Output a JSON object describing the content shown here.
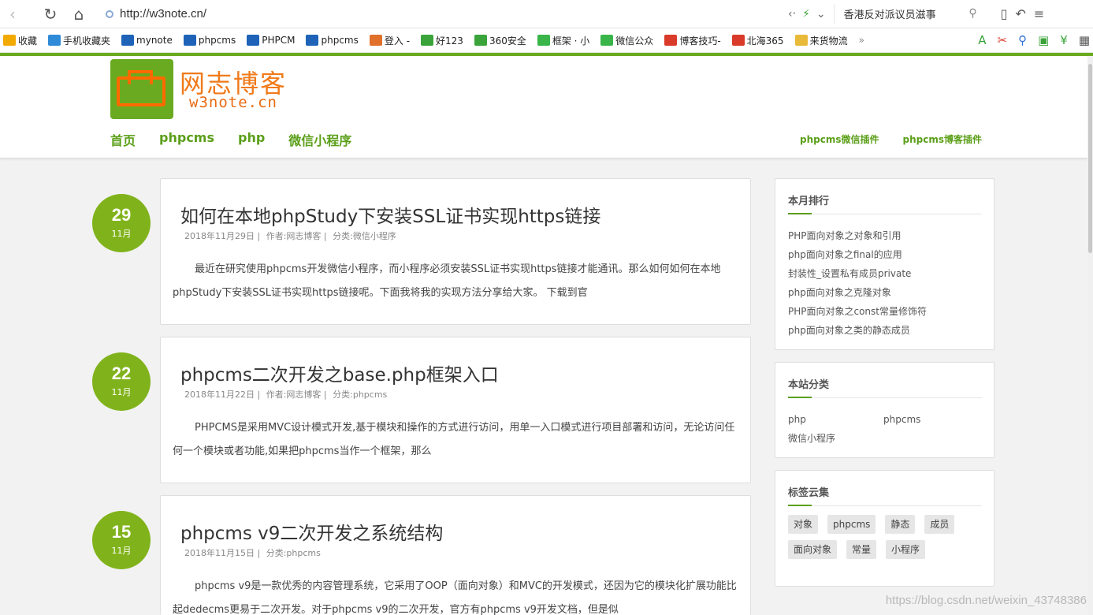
{
  "browser": {
    "url": "http://w3note.cn/",
    "search_text": "香港反对派议员滋事",
    "bookmarks": [
      {
        "label": "收藏",
        "color": "#f2a900",
        "icon": "star-icon"
      },
      {
        "label": "手机收藏夹",
        "color": "#2f8ad8",
        "icon": "phone-icon"
      },
      {
        "label": "mynote",
        "color": "#1e63b8",
        "icon": "pc-icon"
      },
      {
        "label": "phpcms",
        "color": "#1e63b8",
        "icon": "pc-icon"
      },
      {
        "label": "PHPCM",
        "color": "#1e63b8",
        "icon": "pc-icon"
      },
      {
        "label": "phpcms",
        "color": "#1e63b8",
        "icon": "pc-icon"
      },
      {
        "label": "登入 -",
        "color": "#e0702a",
        "icon": "box-icon"
      },
      {
        "label": "好123",
        "color": "#3aa33a",
        "icon": "hao123-icon"
      },
      {
        "label": "360安全",
        "color": "#3aa33a",
        "icon": "shield-icon"
      },
      {
        "label": "框架 · 小",
        "color": "#39b54a",
        "icon": "wechat-icon"
      },
      {
        "label": "微信公众",
        "color": "#39b54a",
        "icon": "wechat-icon"
      },
      {
        "label": "博客技巧-",
        "color": "#d93a2a",
        "icon": "blog-icon"
      },
      {
        "label": "北海365",
        "color": "#d93a2a",
        "icon": "beihai-icon"
      },
      {
        "label": "来货物流",
        "color": "#e9b93a",
        "icon": "folder-icon"
      }
    ],
    "more": "»"
  },
  "site": {
    "logo_title": "网志博客",
    "logo_sub": "w3note.cn",
    "nav": [
      "首页",
      "phpcms",
      "php",
      "微信小程序"
    ],
    "sub_nav": [
      "phpcms微信插件",
      "phpcms博客插件"
    ]
  },
  "posts": [
    {
      "day": "29",
      "month": "11月",
      "title": "如何在本地phpStudy下安装SSL证书实现https链接",
      "date": "2018年11月29日 |",
      "author": "作者:网志博客 |",
      "category": "分类:微信小程序",
      "excerpt": "最近在研究使用phpcms开发微信小程序，而小程序必须安装SSL证书实现https链接才能通讯。那么如何如何在本地phpStudy下安装SSL证书实现https链接呢。下面我将我的实现方法分享给大家。 下载到官"
    },
    {
      "day": "22",
      "month": "11月",
      "title": "phpcms二次开发之base.php框架入口",
      "date": "2018年11月22日 |",
      "author": "作者:网志博客 |",
      "category": "分类:phpcms",
      "excerpt": "PHPCMS是采用MVC设计模式开发,基于模块和操作的方式进行访问，用单一入口模式进行项目部署和访问，无论访问任何一个模块或者功能,如果把phpcms当作一个框架，那么"
    },
    {
      "day": "15",
      "month": "11月",
      "title": "phpcms v9二次开发之系统结构",
      "date": "2018年11月15日 |",
      "author": "",
      "category": "分类:phpcms",
      "excerpt": "phpcms v9是一款优秀的内容管理系统，它采用了OOP（面向对象）和MVC的开发模式，还因为它的模块化扩展功能比起dedecms更易于二次开发。对于phpcms v9的二次开发，官方有phpcms v9开发文档，但是似"
    }
  ],
  "sidebar": {
    "ranking": {
      "title": "本月排行",
      "items": [
        "PHP面向对象之对象和引用",
        "php面向对象之final的应用",
        "封装性_设置私有成员private",
        "php面向对象之克隆对象",
        "PHP面向对象之const常量修饰符",
        "php面向对象之类的静态成员"
      ]
    },
    "categories": {
      "title": "本站分类",
      "items": [
        "php",
        "phpcms",
        "微信小程序"
      ]
    },
    "tags": {
      "title": "标签云集",
      "items": [
        "对象",
        "phpcms",
        "静态",
        "成员",
        "面向对象",
        "常量",
        "小程序"
      ]
    }
  },
  "watermark": "https://blog.csdn.net/weixin_43748386"
}
